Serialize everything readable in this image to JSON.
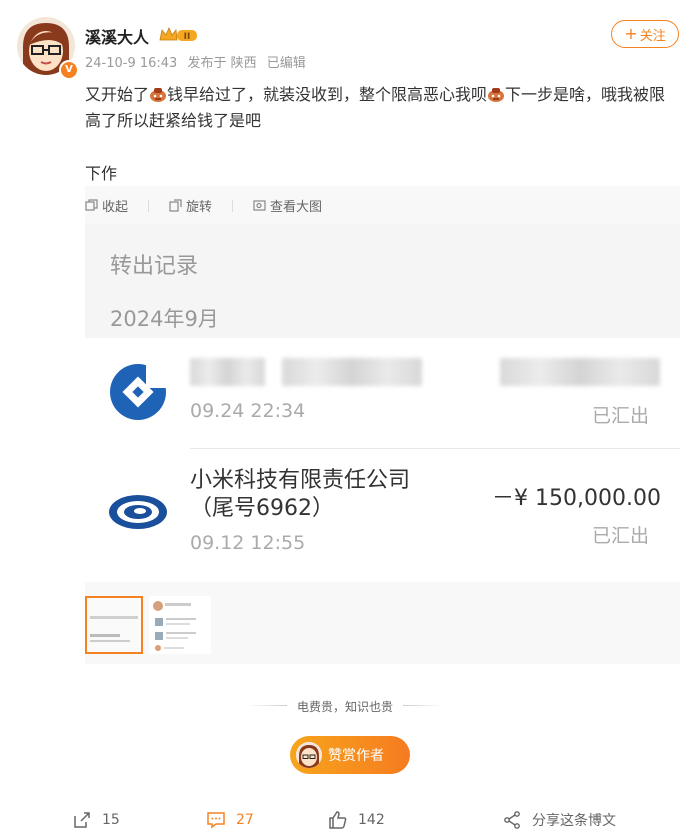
{
  "user": {
    "name": "溪溪大人",
    "level_badge": "II",
    "date": "24-10-9 16:43",
    "location": "发布于 陕西",
    "edited": "已编辑",
    "follow_label": "关注"
  },
  "post": {
    "text_a": "又开始了",
    "text_b": "钱早给过了，就装没收到，整个限高恶心我呗",
    "text_c": "下一步是啥，哦我被限高了所以赶紧给钱了是吧",
    "text_d": "下作"
  },
  "media_tools": {
    "collapse": "收起",
    "rotate": "旋转",
    "view_large": "查看大图"
  },
  "screenshot": {
    "title": "转出记录",
    "month": "2024年9月",
    "records": [
      {
        "time": "09.24 22:34",
        "status": "已汇出"
      },
      {
        "company_line1": "小米科技有限责任公司",
        "company_line2": "（尾号6962）",
        "amount": "－¥ 150,000.00",
        "time": "09.12 12:55",
        "status": "已汇出"
      }
    ]
  },
  "footer": {
    "slogan": "电费贵，知识也贵",
    "reward_label": "赞赏作者",
    "repost_count": "15",
    "comment_count": "27",
    "like_count": "142",
    "share_label": "分享这条博文"
  },
  "colors": {
    "accent": "#f58220",
    "ccb_blue": "#1e63b5",
    "unionpay_blue": "#1a4f9c"
  }
}
